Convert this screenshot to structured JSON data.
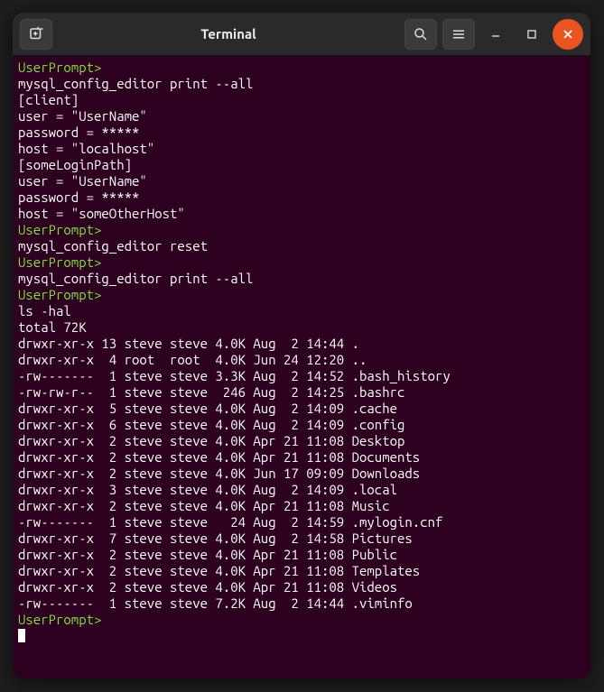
{
  "window": {
    "title": "Terminal"
  },
  "prompts": {
    "text": "UserPrompt>"
  },
  "session": {
    "block1": {
      "command": "mysql_config_editor print --all",
      "output": "[client]\nuser = \"UserName\"\npassword = *****\nhost = \"localhost\"\n[someLoginPath]\nuser = \"UserName\"\npassword = *****\nhost = \"someOtherHost\""
    },
    "block2": {
      "command": "mysql_config_editor reset",
      "output": ""
    },
    "block3": {
      "command": "mysql_config_editor print --all",
      "output": ""
    },
    "block4": {
      "command": "ls -hal",
      "output": "total 72K\ndrwxr-xr-x 13 steve steve 4.0K Aug  2 14:44 .\ndrwxr-xr-x  4 root  root  4.0K Jun 24 12:20 ..\n-rw-------  1 steve steve 3.3K Aug  2 14:52 .bash_history\n-rw-rw-r--  1 steve steve  246 Aug  2 14:25 .bashrc\ndrwxr-xr-x  5 steve steve 4.0K Aug  2 14:09 .cache\ndrwxr-xr-x  6 steve steve 4.0K Aug  2 14:09 .config\ndrwxr-xr-x  2 steve steve 4.0K Apr 21 11:08 Desktop\ndrwxr-xr-x  2 steve steve 4.0K Apr 21 11:08 Documents\ndrwxr-xr-x  2 steve steve 4.0K Jun 17 09:09 Downloads\ndrwxr-xr-x  3 steve steve 4.0K Aug  2 14:09 .local\ndrwxr-xr-x  2 steve steve 4.0K Apr 21 11:08 Music\n-rw-------  1 steve steve   24 Aug  2 14:59 .mylogin.cnf\ndrwxr-xr-x  7 steve steve 4.0K Aug  2 14:58 Pictures\ndrwxr-xr-x  2 steve steve 4.0K Apr 21 11:08 Public\ndrwxr-xr-x  2 steve steve 4.0K Apr 21 11:08 Templates\ndrwxr-xr-x  2 steve steve 4.0K Apr 21 11:08 Videos\n-rw-------  1 steve steve 7.2K Aug  2 14:44 .viminfo"
    }
  }
}
